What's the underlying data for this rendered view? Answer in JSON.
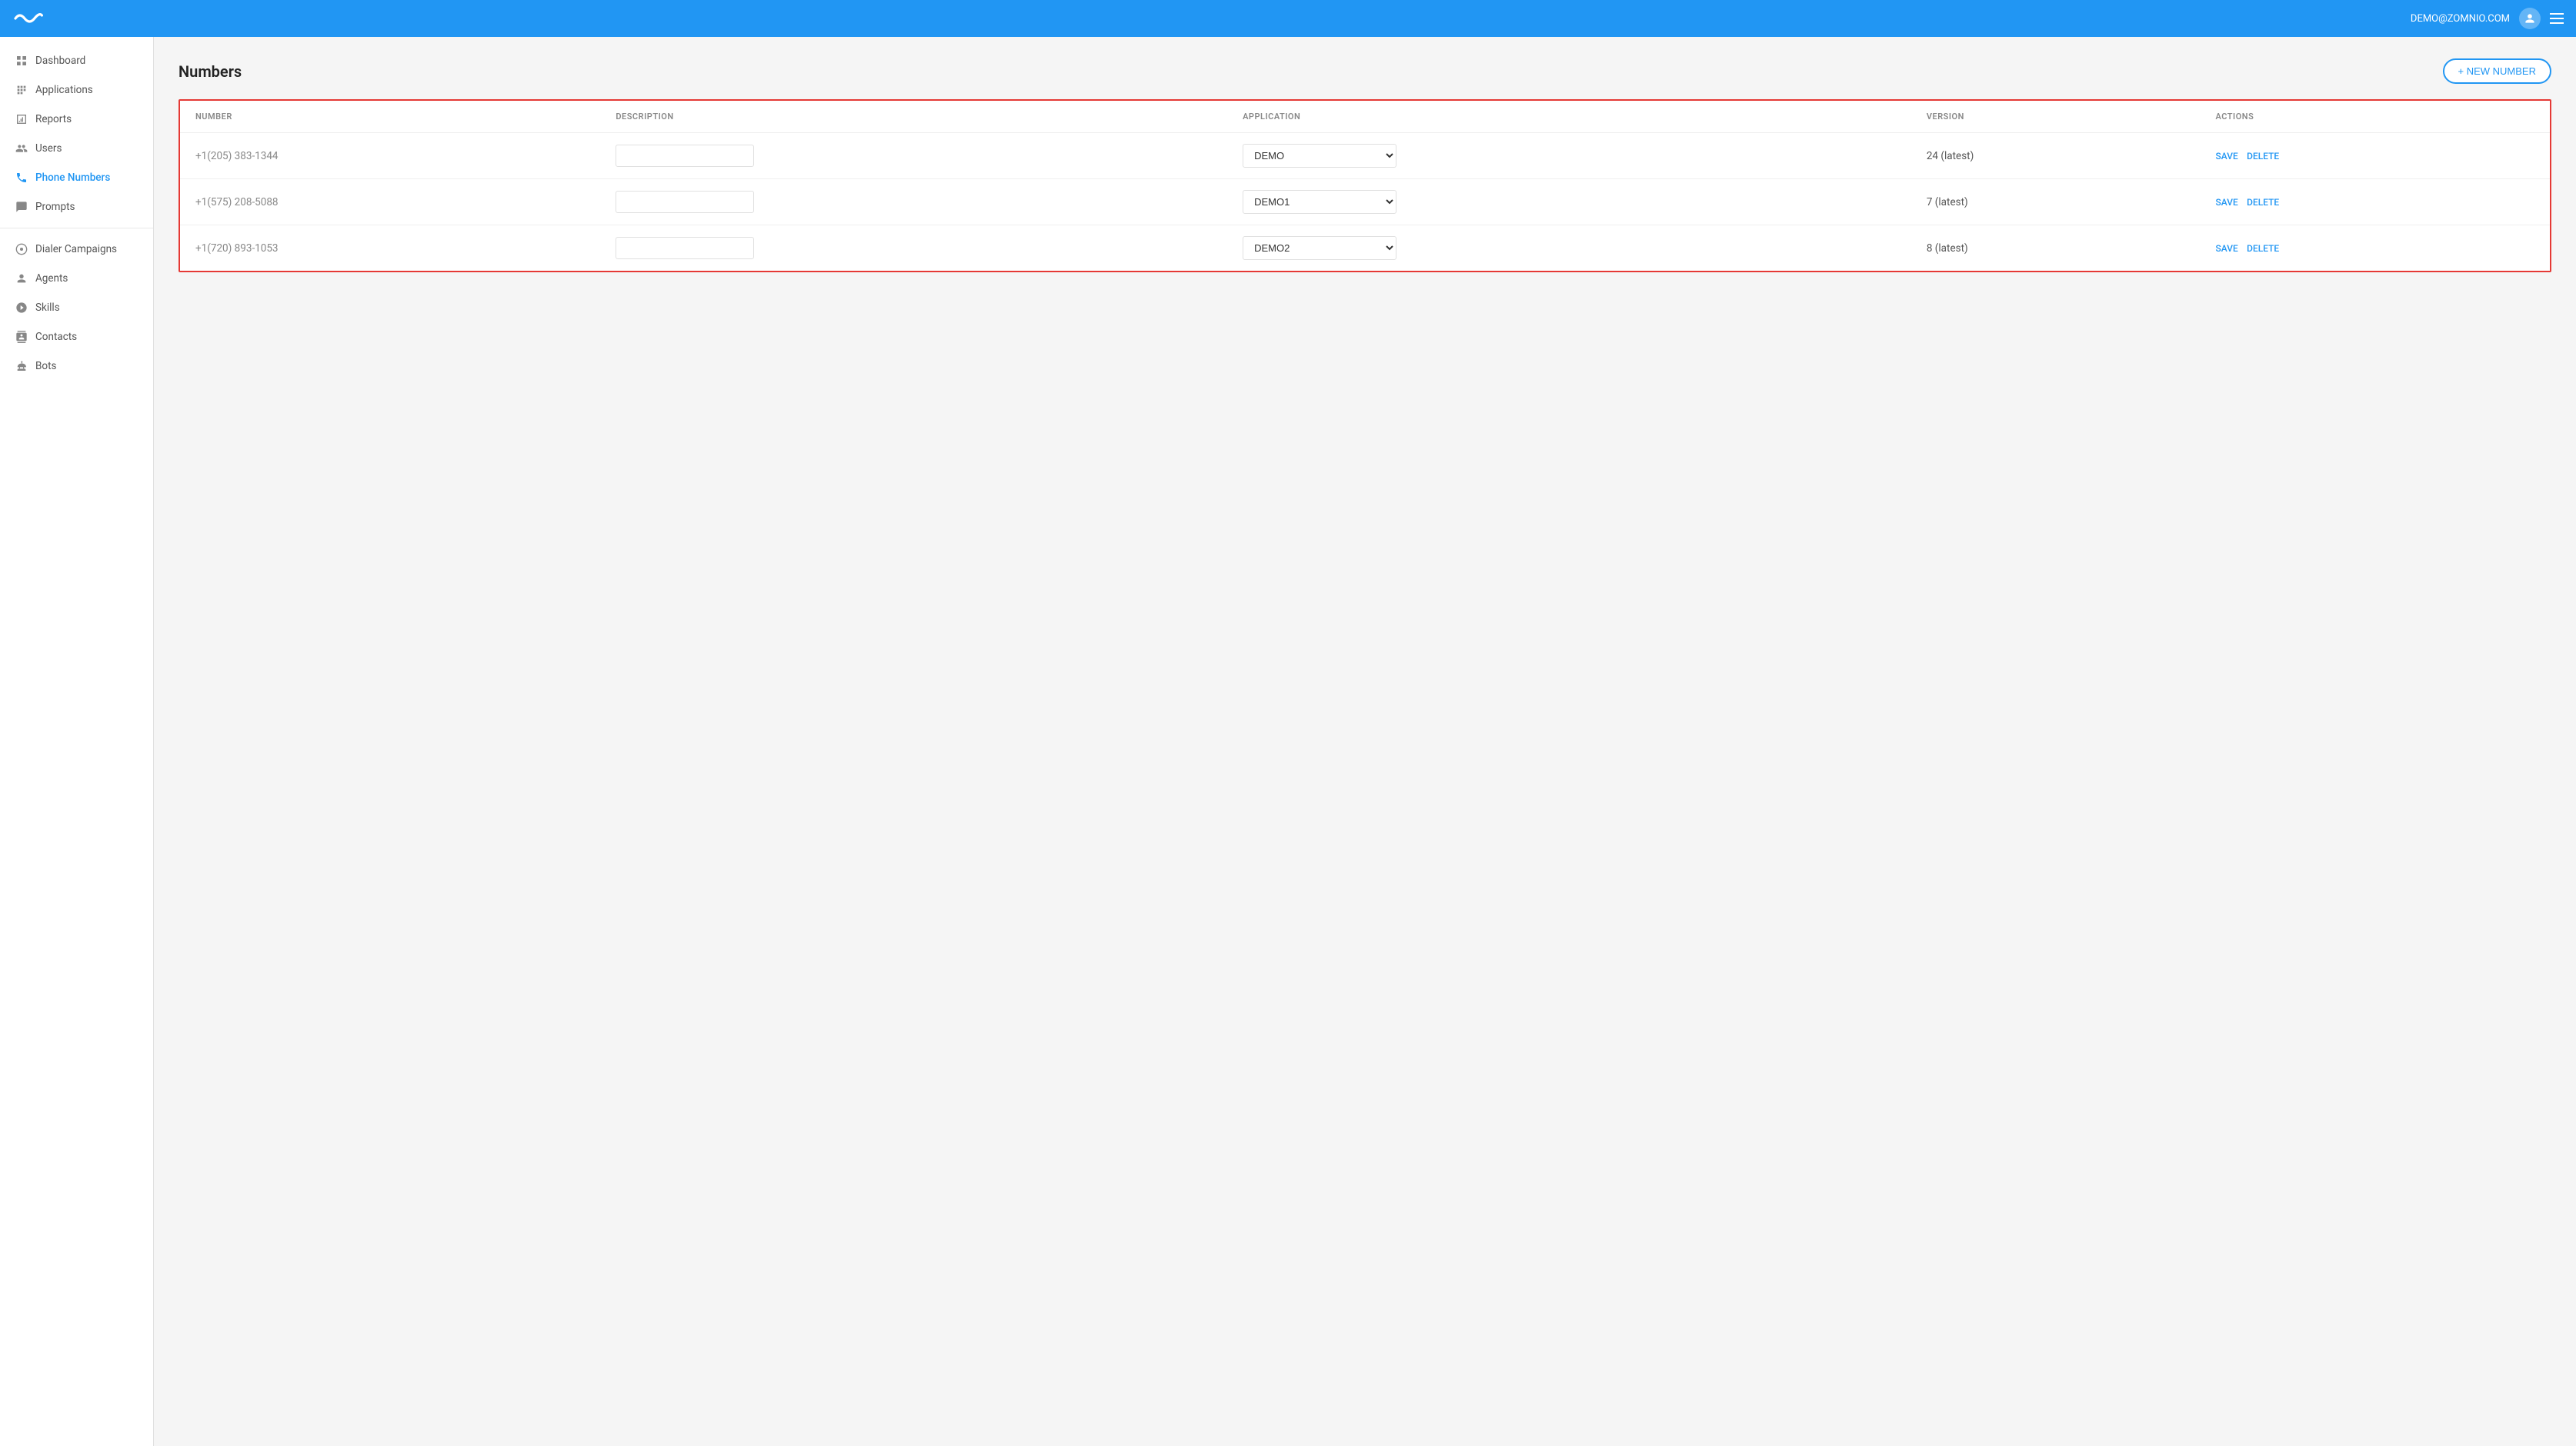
{
  "header": {
    "user_email": "DEMO@ZOMNIO.COM"
  },
  "sidebar": {
    "items": [
      {
        "id": "dashboard",
        "label": "Dashboard",
        "icon": "dashboard-icon"
      },
      {
        "id": "applications",
        "label": "Applications",
        "icon": "applications-icon"
      },
      {
        "id": "reports",
        "label": "Reports",
        "icon": "reports-icon"
      },
      {
        "id": "users",
        "label": "Users",
        "icon": "users-icon"
      },
      {
        "id": "phone-numbers",
        "label": "Phone Numbers",
        "icon": "phone-icon",
        "active": true
      },
      {
        "id": "prompts",
        "label": "Prompts",
        "icon": "prompts-icon"
      },
      {
        "id": "dialer-campaigns",
        "label": "Dialer Campaigns",
        "icon": "dialer-icon"
      },
      {
        "id": "agents",
        "label": "Agents",
        "icon": "agents-icon"
      },
      {
        "id": "skills",
        "label": "Skills",
        "icon": "skills-icon"
      },
      {
        "id": "contacts",
        "label": "Contacts",
        "icon": "contacts-icon"
      },
      {
        "id": "bots",
        "label": "Bots",
        "icon": "bots-icon"
      }
    ]
  },
  "page": {
    "title": "Numbers",
    "new_number_label": "+ NEW NUMBER"
  },
  "table": {
    "columns": [
      {
        "key": "number",
        "label": "NUMBER"
      },
      {
        "key": "description",
        "label": "DESCRIPTION"
      },
      {
        "key": "application",
        "label": "APPLICATION"
      },
      {
        "key": "version",
        "label": "VERSION"
      },
      {
        "key": "actions",
        "label": "ACTIONS"
      }
    ],
    "rows": [
      {
        "number": "+1(205) 383-1344",
        "description": "",
        "application": "DEMO",
        "version": "24 (latest)"
      },
      {
        "number": "+1(575) 208-5088",
        "description": "",
        "application": "DEMO1",
        "version": "7 (latest)"
      },
      {
        "number": "+1(720) 893-1053",
        "description": "",
        "application": "DEMO2",
        "version": "8 (latest)"
      }
    ],
    "save_label": "SAVE",
    "delete_label": "DELETE"
  }
}
